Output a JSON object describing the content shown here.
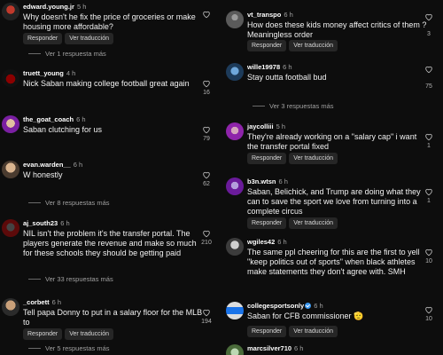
{
  "ui": {
    "reply_label": "Responder",
    "translate_label": "Ver traducción"
  },
  "left_comments": [
    {
      "user": "edward.young.jr",
      "time": "5 h",
      "text": "Why doesn't he fix the price of groceries or make housing more affordable?",
      "likes": "",
      "replies": "Ver 1 respuesta más"
    },
    {
      "user": "truett_young",
      "time": "4 h",
      "text": "Nick Saban making college football great again",
      "likes": "16",
      "replies": ""
    },
    {
      "user": "the_goat_coach",
      "time": "6 h",
      "text": "Saban clutching for us",
      "likes": "79",
      "replies": ""
    },
    {
      "user": "evan.warden__",
      "time": "6 h",
      "text": "W honestly",
      "likes": "62",
      "replies": "Ver 8 respuestas más"
    },
    {
      "user": "aj_south23",
      "time": "6 h",
      "text": "NIL isn't the problem it's the transfer portal. The players generate the revenue and make so much for these schools they should be getting paid",
      "likes": "210",
      "replies": "Ver 33 respuestas más"
    },
    {
      "user": "_corbett",
      "time": "6 h",
      "text": "Tell papa Donny to put in a salary floor for the MLB to",
      "likes": "194",
      "replies": "Ver 5 respuestas más"
    }
  ],
  "right_comments": [
    {
      "user": "vt_transpo",
      "time": "6 h",
      "text": "How does these kids money affect critics of them ? Meaningless order",
      "likes": "3",
      "replies": ""
    },
    {
      "user": "wille19978",
      "time": "6 h",
      "text": "Stay outta football bud",
      "likes": "75",
      "replies": "Ver 3 respuestas más"
    },
    {
      "user": "jaycolliii",
      "time": "5 h",
      "text": "They're already working on a \"salary cap\" i want the transfer portal fixed",
      "likes": "1",
      "replies": ""
    },
    {
      "user": "b3n.wtsn",
      "time": "6 h",
      "text": "Saban, Belichick, and Trump are doing what they can to save the sport we love from turning into a complete circus",
      "likes": "1",
      "replies": ""
    },
    {
      "user": "wgiles42",
      "time": "6 h",
      "text": "The same ppl cheering for this are the first to yell \"keep politics out of sports\" when black athletes make statements they don't agree with. SMH",
      "likes": "10",
      "replies": ""
    },
    {
      "user": "collegesportsonly",
      "time": "6 h",
      "text": "Saban for CFB commissioner 🫡",
      "likes": "10",
      "replies": "",
      "verified": true
    },
    {
      "user": "marcsilver710",
      "time": "6 h",
      "text": "",
      "likes": "",
      "replies": ""
    }
  ],
  "colors": {
    "background": "#0d0d0d",
    "pill": "#262626",
    "muted": "#a0a0a0",
    "verified": "#3897f0"
  }
}
